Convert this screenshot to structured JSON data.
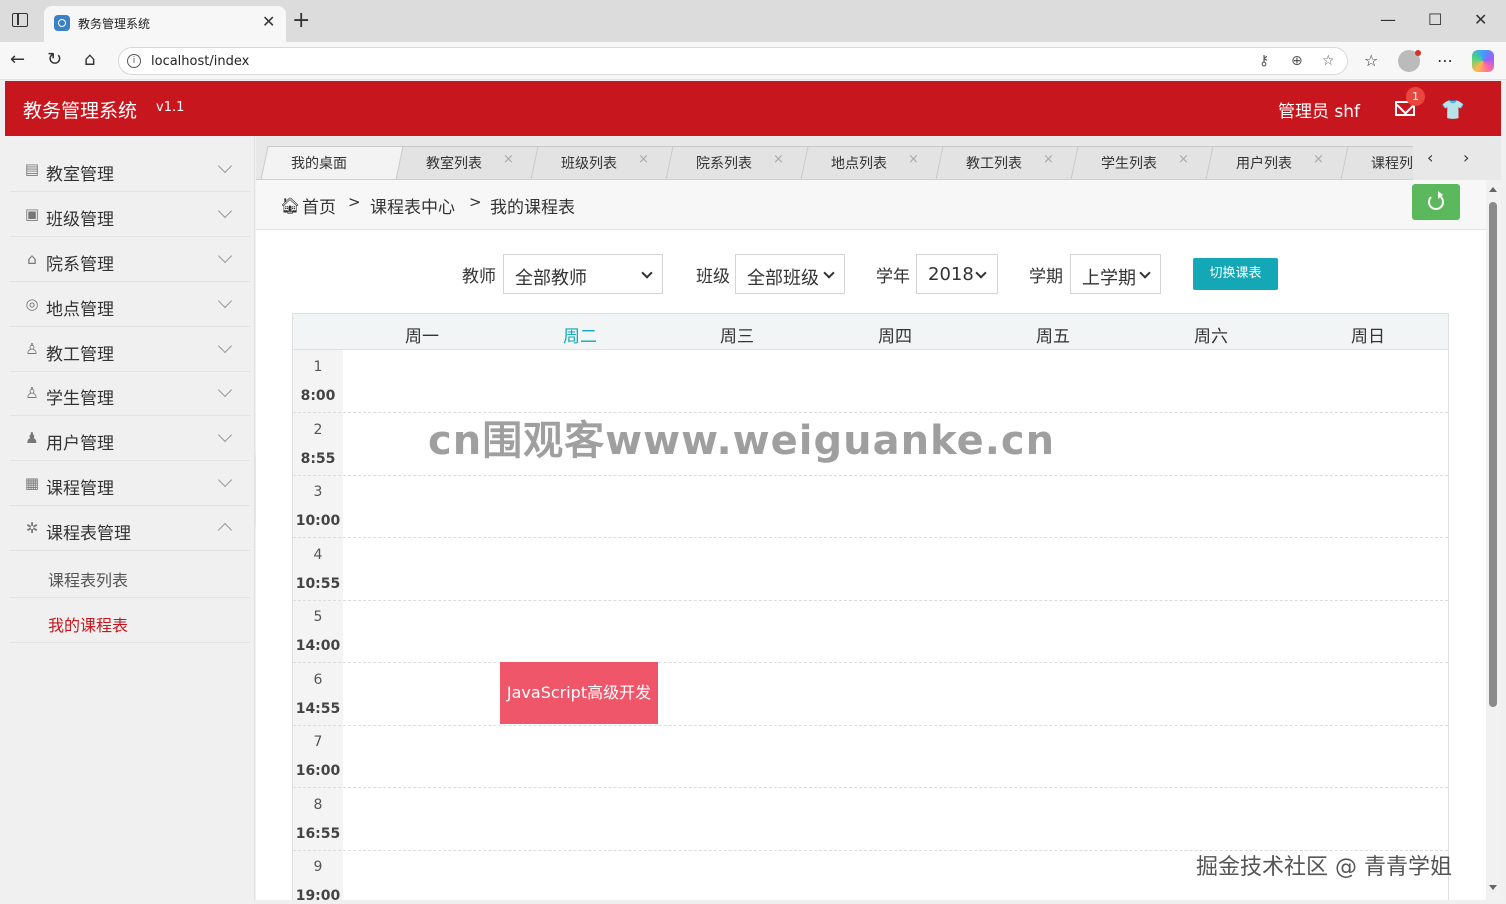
{
  "browser": {
    "tab_title": "教务管理系统",
    "tab_close": "✕",
    "new_tab": "+",
    "url": "localhost/index",
    "window_minimize": "—",
    "window_maximize": "☐",
    "window_close": "✕"
  },
  "header": {
    "title": "教务管理系统",
    "version": "v1.1",
    "user": "管理员  shf",
    "mail_badge": "1"
  },
  "sidebar": {
    "items": [
      {
        "label": "教室管理",
        "icon": "classroom-icon"
      },
      {
        "label": "班级管理",
        "icon": "class-icon"
      },
      {
        "label": "院系管理",
        "icon": "department-icon"
      },
      {
        "label": "地点管理",
        "icon": "location-icon"
      },
      {
        "label": "教工管理",
        "icon": "staff-icon"
      },
      {
        "label": "学生管理",
        "icon": "student-icon"
      },
      {
        "label": "用户管理",
        "icon": "user-icon"
      },
      {
        "label": "课程管理",
        "icon": "course-icon"
      },
      {
        "label": "课程表管理",
        "icon": "schedule-icon",
        "expanded": true
      }
    ],
    "subitems": [
      {
        "label": "课程表列表",
        "active": false
      },
      {
        "label": "我的课程表",
        "active": true
      }
    ]
  },
  "page_tabs": {
    "tabs": [
      {
        "label": "我的桌面",
        "closable": false
      },
      {
        "label": "教室列表",
        "closable": true
      },
      {
        "label": "班级列表",
        "closable": true
      },
      {
        "label": "院系列表",
        "closable": true
      },
      {
        "label": "地点列表",
        "closable": true
      },
      {
        "label": "教工列表",
        "closable": true
      },
      {
        "label": "学生列表",
        "closable": true
      },
      {
        "label": "用户列表",
        "closable": true
      },
      {
        "label": "课程列表",
        "closable": true
      }
    ],
    "close_glyph": "×",
    "prev": "‹",
    "next": "›"
  },
  "breadcrumb": {
    "items": [
      "首页",
      "课程表中心",
      "我的课程表"
    ],
    "separator": ">"
  },
  "filters": {
    "teacher": {
      "label": "教师",
      "value": "全部教师"
    },
    "class": {
      "label": "班级",
      "value": "全部班级"
    },
    "year": {
      "label": "学年",
      "value": "2018"
    },
    "term": {
      "label": "学期",
      "value": "上学期"
    },
    "switch_button": "切换课表"
  },
  "timetable": {
    "days": [
      "周一",
      "周二",
      "周三",
      "周四",
      "周五",
      "周六",
      "周日"
    ],
    "highlighted_day": "周二",
    "periods": [
      {
        "num": "1",
        "time": "8:00"
      },
      {
        "num": "2",
        "time": "8:55"
      },
      {
        "num": "3",
        "time": "10:00"
      },
      {
        "num": "4",
        "time": "10:55"
      },
      {
        "num": "5",
        "time": "14:00"
      },
      {
        "num": "6",
        "time": "14:55"
      },
      {
        "num": "7",
        "time": "16:00"
      },
      {
        "num": "8",
        "time": "16:55"
      },
      {
        "num": "9",
        "time": "19:00"
      }
    ],
    "courses": [
      {
        "name": "JavaScript高级开发",
        "day": "周二",
        "period": "6",
        "color": "#f0566a"
      }
    ]
  },
  "colors": {
    "brand": "#c8161e",
    "accent": "#14a8b7",
    "refresh": "#5cb85c"
  },
  "watermarks": {
    "center": "cn围观客www.weiguanke.cn",
    "corner": "掘金技术社区 @ 青青学姐"
  }
}
